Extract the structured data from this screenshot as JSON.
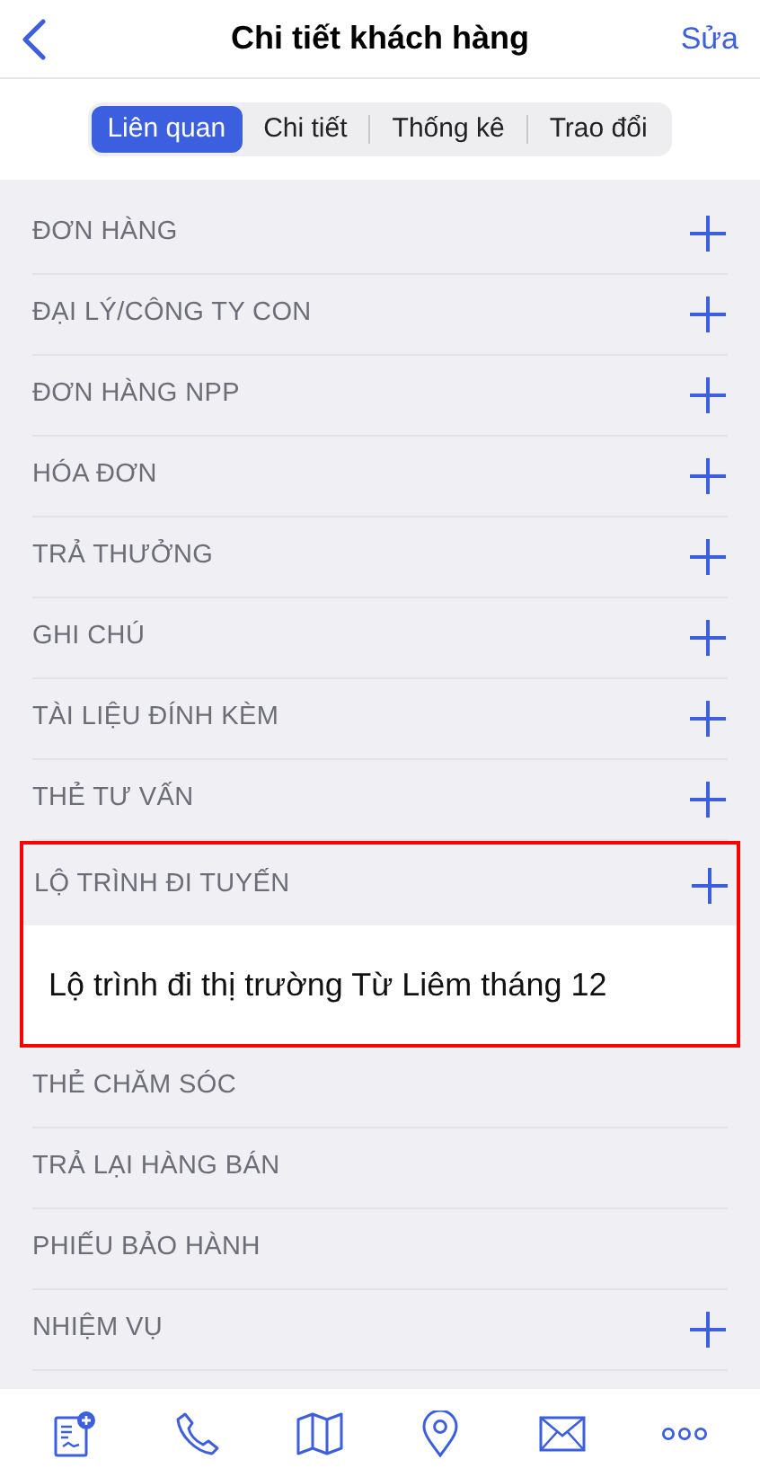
{
  "nav": {
    "title": "Chi tiết khách hàng",
    "action": "Sửa"
  },
  "tabs": [
    {
      "label": "Liên quan",
      "selected": true
    },
    {
      "label": "Chi tiết",
      "selected": false
    },
    {
      "label": "Thống kê",
      "selected": false
    },
    {
      "label": "Trao đổi",
      "selected": false
    }
  ],
  "sections": [
    {
      "label": "ĐƠN HÀNG",
      "addable": true
    },
    {
      "label": "ĐẠI LÝ/CÔNG TY CON",
      "addable": true
    },
    {
      "label": "ĐƠN HÀNG NPP",
      "addable": true
    },
    {
      "label": "HÓA ĐƠN",
      "addable": true
    },
    {
      "label": "TRẢ THƯỞNG",
      "addable": true
    },
    {
      "label": "GHI CHÚ",
      "addable": true
    },
    {
      "label": "TÀI LIỆU ĐÍNH KÈM",
      "addable": true
    },
    {
      "label": "THẺ TƯ VẤN",
      "addable": true
    },
    {
      "label": "LỘ TRÌNH ĐI TUYẾN",
      "addable": true,
      "highlighted": true,
      "items": [
        "Lộ trình đi thị trường Từ Liêm tháng 12"
      ]
    },
    {
      "label": "THẺ CHĂM SÓC",
      "addable": false
    },
    {
      "label": "TRẢ LẠI HÀNG BÁN",
      "addable": false
    },
    {
      "label": "PHIẾU BẢO HÀNH",
      "addable": false
    },
    {
      "label": "NHIỆM VỤ",
      "addable": true
    }
  ],
  "toolbar": [
    {
      "kind": "report"
    },
    {
      "kind": "phone"
    },
    {
      "kind": "map"
    },
    {
      "kind": "pin"
    },
    {
      "kind": "mail"
    },
    {
      "kind": "more"
    }
  ]
}
